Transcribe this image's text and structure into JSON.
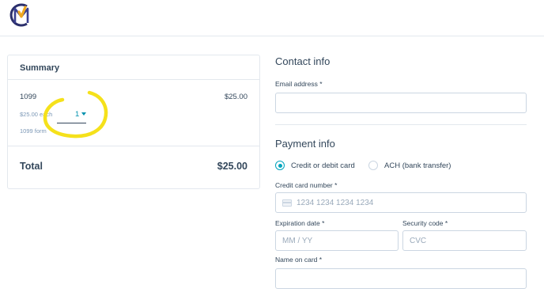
{
  "header": {
    "logo": "company-logo"
  },
  "summary": {
    "title": "Summary",
    "item": {
      "name": "1099",
      "price": "$25.00",
      "each": "$25.00 each",
      "quantity": "1",
      "description": "1099 form"
    },
    "total_label": "Total",
    "total_value": "$25.00"
  },
  "contact": {
    "title": "Contact info",
    "email_label": "Email address *",
    "email_value": ""
  },
  "payment": {
    "title": "Payment info",
    "methods": [
      {
        "label": "Credit or debit card",
        "selected": true
      },
      {
        "label": "ACH (bank transfer)",
        "selected": false
      }
    ],
    "card_number_label": "Credit card number *",
    "card_number_placeholder": "1234 1234 1234 1234",
    "expiration_label": "Expiration date *",
    "expiration_placeholder": "MM / YY",
    "security_label": "Security code *",
    "security_placeholder": "CVC",
    "name_label": "Name on card *",
    "name_value": ""
  },
  "colors": {
    "accent": "#00a4bd",
    "text": "#33475b",
    "highlight": "#f5e11b",
    "border": "#cbd6e2"
  }
}
